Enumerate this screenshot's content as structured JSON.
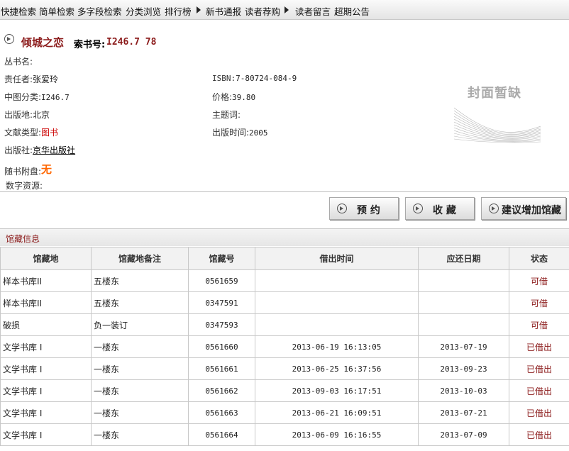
{
  "nav": {
    "items": [
      "快捷检索",
      "简单检索",
      "多字段检索",
      "分类浏览",
      "排行榜",
      "新书通报",
      "读者荐购",
      "读者留言",
      "超期公告"
    ]
  },
  "book": {
    "title": "倾城之恋",
    "call_no_label": "索书号:",
    "call_no": "I246.7 78",
    "fields": {
      "series_label": "丛书名:",
      "author_label": "责任者:",
      "author": "张爱玲",
      "isbn_label": "ISBN:",
      "isbn": "7-80724-084-9",
      "clc_label": "中图分类:",
      "clc": "I246.7",
      "price_label": "价格:",
      "price": "39.80",
      "place_label": "出版地:",
      "place": "北京",
      "subject_label": "主题词:",
      "doctype_label": "文献类型:",
      "doctype": "图书",
      "pubdate_label": "出版时间:",
      "pubdate": "2005",
      "publisher_label": "出版社:",
      "publisher": "京华出版社",
      "disc_label": "随书附盘:",
      "disc": "无",
      "digital_label": "数字资源:"
    },
    "cover_text": "封面暂缺"
  },
  "actions": {
    "reserve": "预 约",
    "favorite": "收 藏",
    "suggest": "建议增加馆藏"
  },
  "holdings": {
    "section_title": "馆藏信息",
    "headers": [
      "馆藏地",
      "馆藏地备注",
      "馆藏号",
      "借出时间",
      "应还日期",
      "状态"
    ],
    "rows": [
      [
        "样本书库II",
        "五楼东",
        "0561659",
        "",
        "",
        "可借"
      ],
      [
        "样本书库II",
        "五楼东",
        "0347591",
        "",
        "",
        "可借"
      ],
      [
        "破损",
        "负一装订",
        "0347593",
        "",
        "",
        "可借"
      ],
      [
        "文学书库 I",
        "一楼东",
        "0561660",
        "2013-06-19 16:13:05",
        "2013-07-19",
        "已借出"
      ],
      [
        "文学书库 I",
        "一楼东",
        "0561661",
        "2013-06-25 16:37:56",
        "2013-09-23",
        "已借出"
      ],
      [
        "文学书库 I",
        "一楼东",
        "0561662",
        "2013-09-03 16:17:51",
        "2013-10-03",
        "已借出"
      ],
      [
        "文学书库 I",
        "一楼东",
        "0561663",
        "2013-06-21 16:09:51",
        "2013-07-21",
        "已借出"
      ],
      [
        "文学书库 I",
        "一楼东",
        "0561664",
        "2013-06-09 16:16:55",
        "2013-07-09",
        "已借出"
      ]
    ]
  },
  "colors": {
    "accent": "#8b1a1a",
    "link_red": "#cc0000",
    "orange": "#ff6600"
  }
}
